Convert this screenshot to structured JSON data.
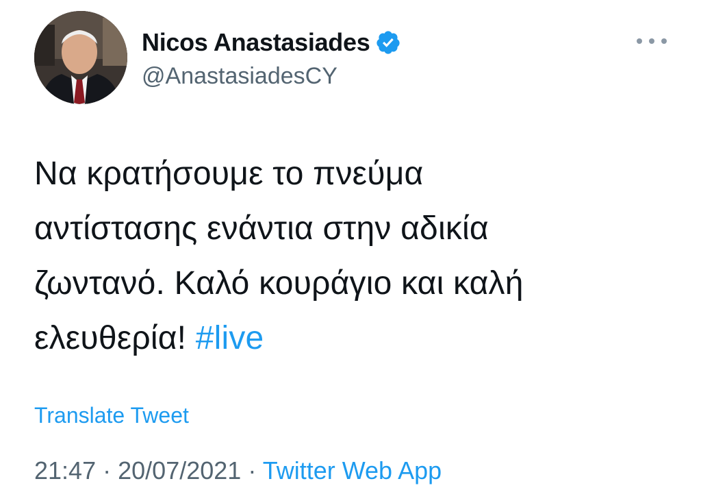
{
  "author": {
    "display_name": "Nicos Anastasiades",
    "handle": "@AnastasiadesCY",
    "verified": true,
    "avatar_icon": "profile-photo"
  },
  "tweet": {
    "lines": [
      "Να κρατήσουμε το πνεύμα",
      "αντίστασης ενάντια στην αδικία",
      "ζωντανό. Καλό κουράγιο και καλή",
      "ελευθερία! "
    ],
    "hashtag": "#live"
  },
  "actions": {
    "translate_label": "Translate Tweet",
    "more_icon": "more-options-icon"
  },
  "meta": {
    "time": "21:47",
    "separator": "·",
    "date": "20/07/2021",
    "source": "Twitter Web App"
  },
  "colors": {
    "link": "#1d9bf0",
    "secondary": "#536471",
    "text": "#0f1419"
  }
}
